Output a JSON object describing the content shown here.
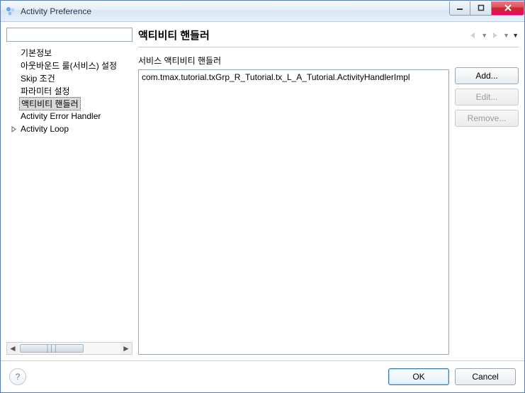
{
  "window": {
    "title": "Activity Preference"
  },
  "sidebar": {
    "search_value": "",
    "items": [
      {
        "label": "기본정보"
      },
      {
        "label": "아웃바운드 룰(서비스) 설정"
      },
      {
        "label": "Skip 조건"
      },
      {
        "label": "파라미터 설정"
      },
      {
        "label": "액티비티 핸들러"
      },
      {
        "label": "Activity Error Handler"
      },
      {
        "label": "Activity Loop",
        "has_children": true
      }
    ],
    "selected_index": 4
  },
  "main": {
    "heading": "액티비티 핸들러",
    "field_label": "서비스 액티비티 핸들러",
    "list_items": [
      "com.tmax.tutorial.txGrp_R_Tutorial.tx_L_A_Tutorial.ActivityHandlerImpl"
    ],
    "buttons": {
      "add": "Add...",
      "edit": "Edit...",
      "remove": "Remove..."
    }
  },
  "footer": {
    "ok": "OK",
    "cancel": "Cancel"
  }
}
